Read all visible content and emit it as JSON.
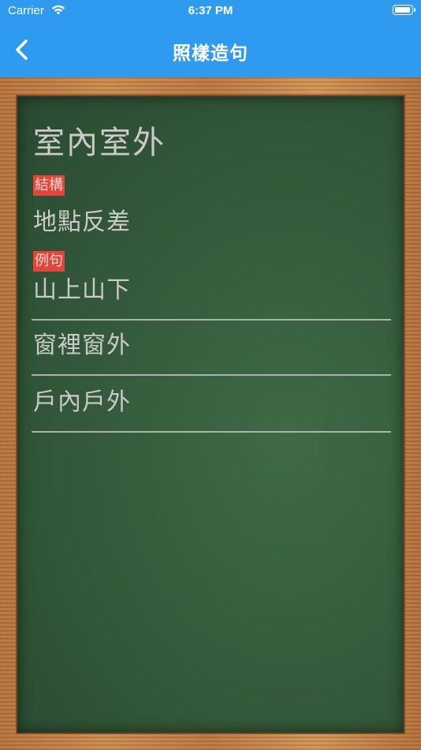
{
  "status_bar": {
    "carrier": "Carrier",
    "time": "6:37 PM",
    "battery_level": 1.0
  },
  "nav": {
    "title": "照樣造句",
    "back_icon": "chevron-left-icon"
  },
  "board": {
    "title": "室內室外",
    "structure_label": "結構",
    "structure_value": "地點反差",
    "examples_label": "例句",
    "examples": [
      "山上山下",
      "窗裡窗外",
      "戶內戶外"
    ]
  },
  "colors": {
    "nav_blue": "#2f9bf0",
    "board_green": "#355c3c",
    "tag_red": "#e2463a",
    "frame_wood": "#c08048"
  }
}
